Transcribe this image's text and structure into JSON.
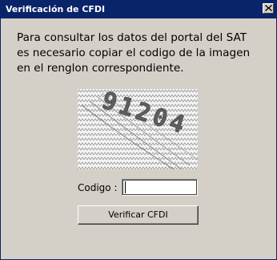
{
  "window": {
    "title": "Verificación de CFDI",
    "title_bar_color": "#0a246a",
    "background_color": "#d4d0c8"
  },
  "message": {
    "lines": [
      "Para consultar los datos del portal del SAT",
      "es necesario copiar el codigo de la imagen",
      "en el renglon correspondiente."
    ]
  },
  "captcha": {
    "text": "91204"
  },
  "form": {
    "code_label": "Codigo :",
    "code_value": "",
    "verify_button_label": "Verificar CFDI"
  },
  "icons": {
    "close": "close-icon"
  }
}
